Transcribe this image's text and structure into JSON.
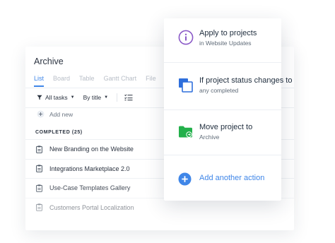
{
  "list_view": {
    "folder_title": "Archive",
    "tabs": [
      "List",
      "Board",
      "Table",
      "Gantt Chart",
      "File"
    ],
    "active_tab": "List",
    "toolbar": {
      "filter_label": "All tasks",
      "sort_label": "By title"
    },
    "add_new_label": "Add new",
    "section_header": "COMPLETED (25)",
    "tasks": [
      "New Branding on the Website",
      "Integrations Marketplace 2.0",
      "Use-Case Templates Gallery",
      "Customers Portal Localization"
    ]
  },
  "automation_card": {
    "actions": [
      {
        "title": "Apply to projects",
        "subtitle": "in Website Updates",
        "icon": "info-circle-icon"
      },
      {
        "title": "If project status changes to",
        "subtitle": "any completed",
        "icon": "status-squares-icon"
      },
      {
        "title": "Move project to",
        "subtitle": "Archive",
        "icon": "folder-move-icon"
      }
    ],
    "add_action_label": "Add another action",
    "colors": {
      "accent": "#3f86e8",
      "info_purple": "#8a59c7",
      "status_blue": "#2f6fdc",
      "folder_green": "#23b04b"
    }
  }
}
